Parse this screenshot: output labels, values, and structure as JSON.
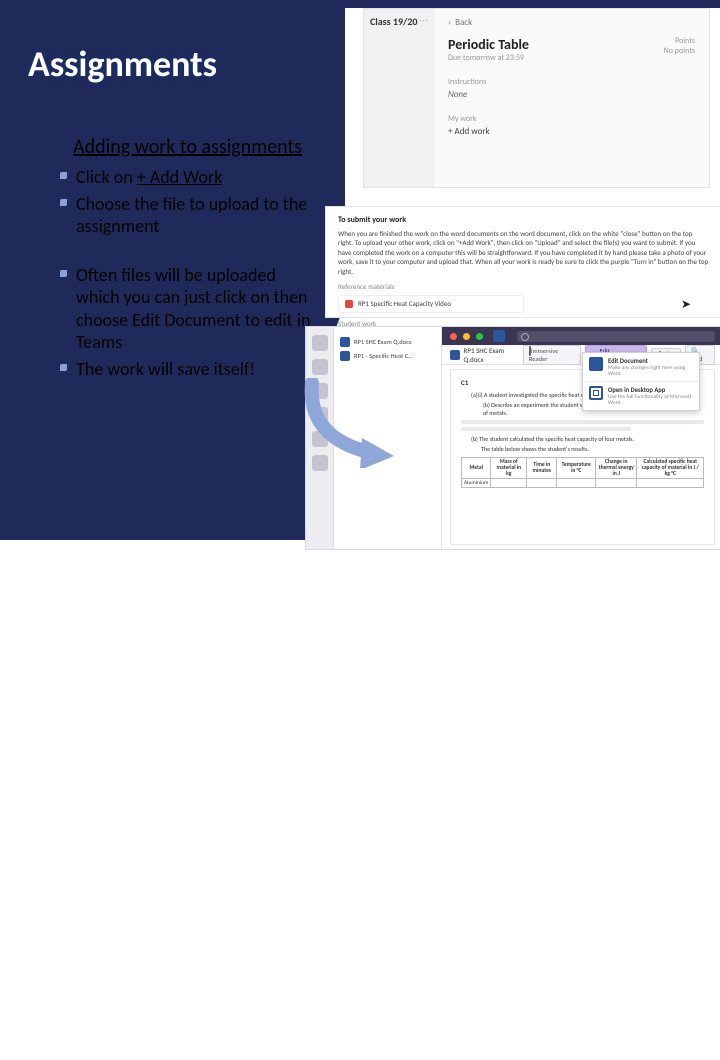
{
  "title": "Assignments",
  "subtitle": "Adding work to assignments",
  "bullets1": [
    {
      "prefix": "Click on ",
      "ul": "+ Add Work",
      "suffix": ""
    },
    {
      "prefix": "Choose the file to upload to the assignment",
      "ul": "",
      "suffix": ""
    }
  ],
  "bullets2": [
    {
      "text": "Often files will be uploaded which you can just click on then choose Edit Document to edit in Teams"
    },
    {
      "text": "The work will save itself!"
    }
  ],
  "shot1": {
    "class_label": "Class 19/20",
    "back": "Back",
    "assignment_title": "Periodic Table",
    "due": "Due tomorrow at 23:59",
    "points_label": "Points",
    "points_value": "No points",
    "instructions_label": "Instructions",
    "instructions_value": "None",
    "my_work_label": "My work",
    "add_work": "+  Add work"
  },
  "shot2": {
    "heading": "To submit your work",
    "body": "When you are finished the work on the word documents on the word document, click on the white \"close\" button on the top right. To upload your other work, click on \"+Add Work\", then click on \"Upload\" and select the file(s) you want to submit. If you have completed the work on a computer this will be straightforward. If you have completed it by hand please take a photo of your work, save it to your computer and upload that. When all your work is ready be sure to click the purple \"Turn in\" button on the top right.",
    "reference_label": "Reference materials",
    "ref_doc": "RP1 Specific Heat Capacity Video",
    "student_work_label": "Student work"
  },
  "shot3": {
    "panel_rows": [
      "RP1 SHC Exam Q.docx",
      "RP1 - Specific Heat C…"
    ],
    "search_placeholder": "Search",
    "doc_filename": "RP1 SHC Exam Q.docx",
    "word_label": "Word",
    "tools": {
      "immersive": "Immersive Reader",
      "edit": "Edit Document",
      "print": "Print",
      "find": "Find"
    },
    "c1_label": "C1",
    "intro_a": "A student investigated the specific heat capacity of metals.",
    "intro_b": "Describe an experiment the student would do to investigate the specific heat capacity of metals.",
    "result_caption": "The student calculated the specific heat capacity of four metals.",
    "table_caption": "The table below shows the student's results.",
    "headers": [
      "Metal",
      "Mass of material in kg",
      "Time in minutes",
      "Temperature in °C",
      "Change in thermal energy in J",
      "Calculated specific heat capacity of material in J / kg °C"
    ],
    "row1": [
      "Aluminium",
      "",
      "",
      "",
      "",
      ""
    ]
  },
  "dropdown": {
    "items": [
      {
        "title": "Edit Document",
        "sub": "Make any changes right here using Word."
      },
      {
        "title": "Open in Desktop App",
        "sub": "Use the full functionality of Microsoft Word."
      }
    ]
  }
}
